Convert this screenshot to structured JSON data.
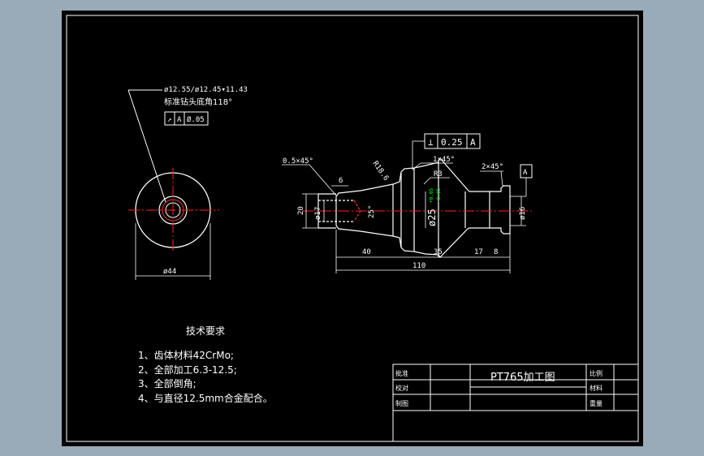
{
  "drawing": {
    "bg_color": "#000000",
    "frame_color": "#ffffff",
    "center_line_color": "#ff0000",
    "highlight_color": "#00ff00",
    "end_view": {
      "hole_note_line1": "ø12.55/ø12.45▾11.43",
      "hole_note_line2": "标准钻头底角118°",
      "tolerance_frame": [
        "↗",
        "A",
        "Ø.05"
      ],
      "outer_diameter": "ø44"
    },
    "side_view": {
      "chamfer_left": "0.5×45°",
      "width_6": "6",
      "radius_top": "R18.6",
      "chamfer_mid": "1×45°",
      "radius_r3": "R3",
      "chamfer_right": "2×45°",
      "datum_a": "A",
      "perp_frame": [
        "⊥",
        "0.25",
        "A"
      ],
      "dia_20": "20",
      "dia_17": "ø17",
      "taper_25": "25°",
      "dia_25": "ø25",
      "fit_upper": "+0.05",
      "fit_lower": "-0.05",
      "dia_16": "ø16",
      "len_40": "40",
      "len_35": "35",
      "len_17": "17",
      "len_8": "8",
      "len_110": "110"
    },
    "tech_requirements": {
      "title": "技术要求",
      "items": [
        "1、齿体材料42CrMo;",
        "2、全部加工6.3-12.5;",
        "3、全部倒角;",
        "4、与直径12.5mm合金配合。"
      ]
    },
    "title_block": {
      "approve": "批准",
      "check": "校对",
      "draw": "制图",
      "drawing_title": "PT765加工图",
      "scale": "比例",
      "material": "材料",
      "weight": "重量"
    }
  }
}
